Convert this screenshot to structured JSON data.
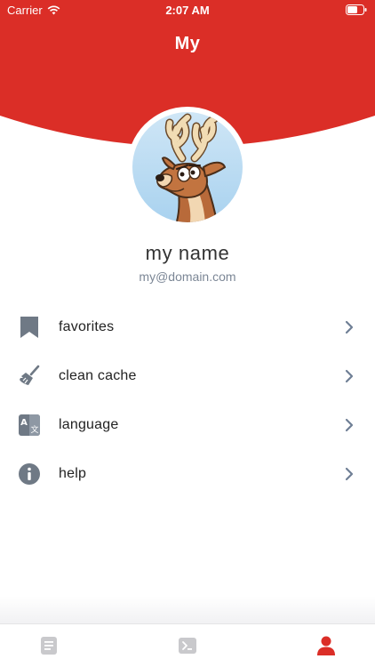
{
  "status_bar": {
    "carrier": "Carrier",
    "time": "2:07 AM"
  },
  "header": {
    "title": "My",
    "color": "#db2e27"
  },
  "profile": {
    "name": "my name",
    "email": "my@domain.com",
    "avatar_icon": "deer-avatar"
  },
  "menu": {
    "items": [
      {
        "label": "favorites",
        "icon": "bookmark-icon"
      },
      {
        "label": "clean cache",
        "icon": "broom-icon"
      },
      {
        "label": "language",
        "icon": "translate-icon"
      },
      {
        "label": "help",
        "icon": "info-icon"
      }
    ]
  },
  "tabbar": {
    "tabs": [
      {
        "icon": "document-icon",
        "active": false
      },
      {
        "icon": "terminal-icon",
        "active": false
      },
      {
        "icon": "user-icon",
        "active": true
      }
    ],
    "active_color": "#db2e27",
    "inactive_color": "#c9c9cc"
  }
}
